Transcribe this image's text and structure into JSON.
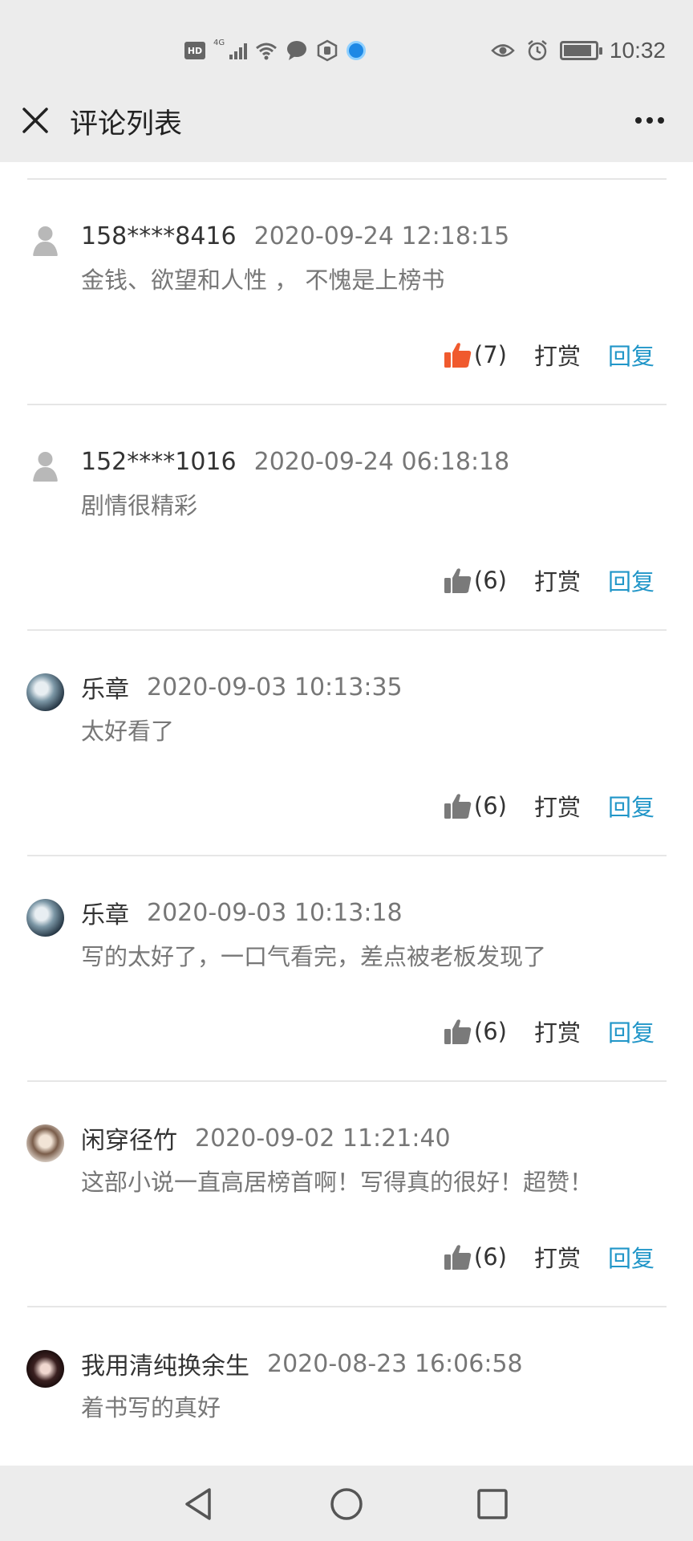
{
  "status_bar": {
    "hd": "HD",
    "network": "4G",
    "time": "10:32"
  },
  "header": {
    "title": "评论列表"
  },
  "comments": [
    {
      "avatar": "default-user-icon",
      "username": "158****8416",
      "time": "2020-09-24 12:18:15",
      "text": "金钱、欲望和人性 ， 不愧是上榜书",
      "likes": "(7)",
      "liked": true,
      "reward": "打赏",
      "reply": "回复"
    },
    {
      "avatar": "default-user-icon",
      "username": "152****1016",
      "time": "2020-09-24 06:18:18",
      "text": "剧情很精彩",
      "likes": "(6)",
      "liked": false,
      "reward": "打赏",
      "reply": "回复"
    },
    {
      "avatar": "photo",
      "username": "乐章",
      "time": "2020-09-03 10:13:35",
      "text": "太好看了",
      "likes": "(6)",
      "liked": false,
      "reward": "打赏",
      "reply": "回复"
    },
    {
      "avatar": "photo",
      "username": "乐章",
      "time": "2020-09-03 10:13:18",
      "text": "写的太好了，一口气看完，差点被老板发现了",
      "likes": "(6)",
      "liked": false,
      "reward": "打赏",
      "reply": "回复"
    },
    {
      "avatar": "photo",
      "username": "闲穿径竹",
      "time": "2020-09-02 11:21:40",
      "text": "这部小说一直高居榜首啊！写得真的很好！超赞！",
      "likes": "(6)",
      "liked": false,
      "reward": "打赏",
      "reply": "回复"
    },
    {
      "avatar": "photo",
      "username": "我用清纯换余生",
      "time": "2020-08-23 16:06:58",
      "text": "着书写的真好"
    }
  ],
  "colors": {
    "liked": "#f05a2e",
    "unliked": "#7a7a7a",
    "reply": "#2196c8",
    "bar_bg": "#ececec"
  }
}
